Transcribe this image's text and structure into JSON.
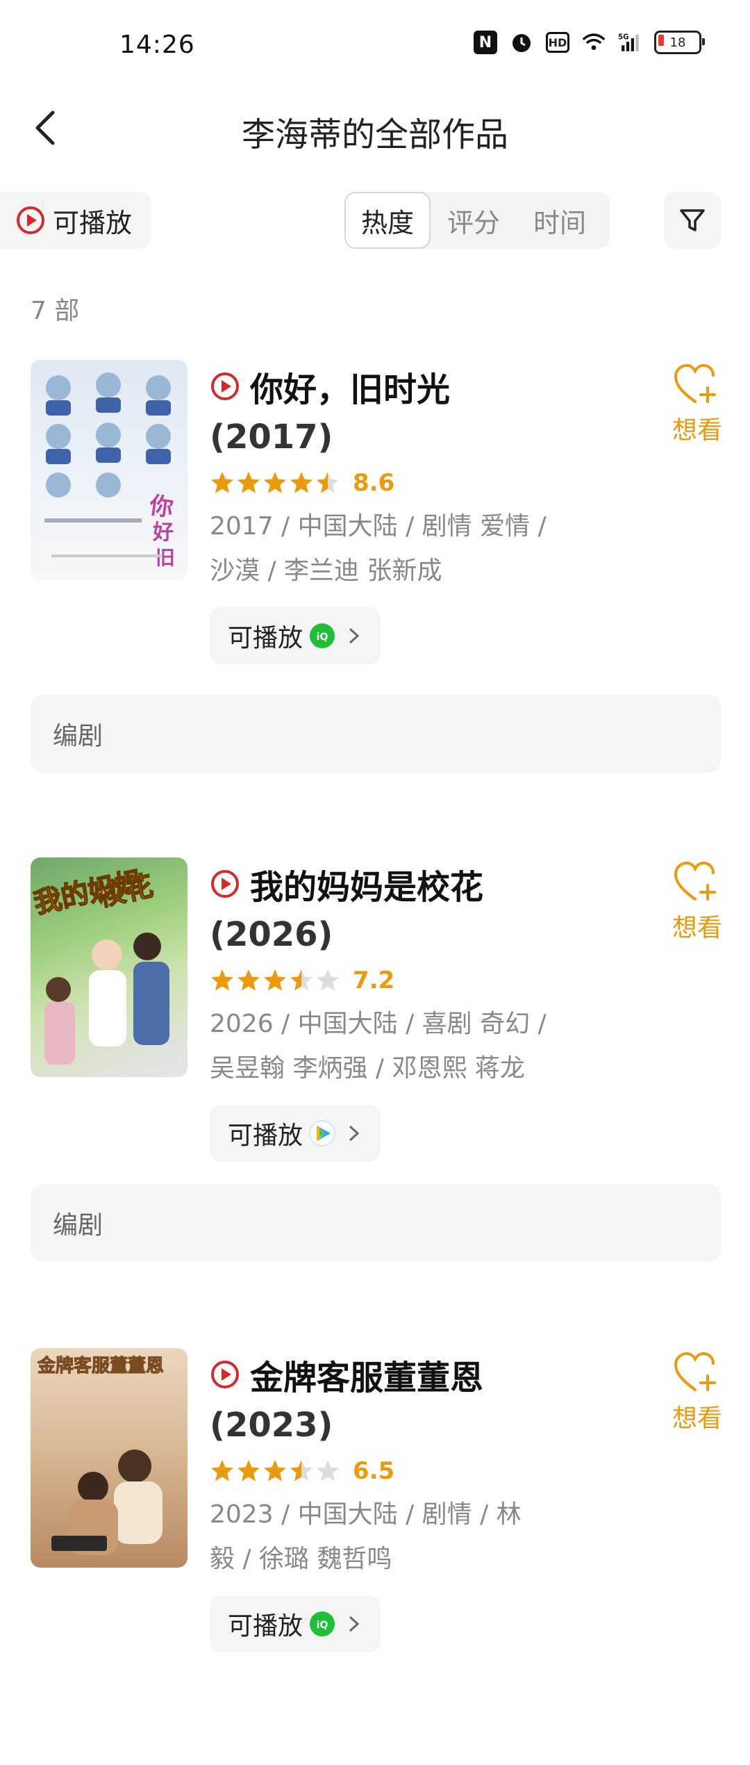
{
  "status_bar": {
    "time": "14:26",
    "icons": [
      "nfc-icon",
      "alarm-icon",
      "hd-icon",
      "wifi-icon",
      "5g-signal-icon"
    ],
    "battery": "18"
  },
  "header": {
    "title": "李海蒂的全部作品",
    "back_icon": "chevron-left-icon"
  },
  "filters": {
    "playable_label": "可播放",
    "sort_tabs": [
      {
        "label": "热度",
        "active": true
      },
      {
        "label": "评分",
        "active": false
      },
      {
        "label": "时间",
        "active": false
      }
    ],
    "filter_icon": "funnel-icon"
  },
  "count_text": "7 部",
  "colors": {
    "accent": "#e99b0d",
    "play_red": "#d42a2a",
    "chip_bg": "#f5f5f5"
  },
  "works": [
    {
      "title": "你好，旧时光",
      "year": "(2017)",
      "rating": 8.6,
      "stars": 4.5,
      "meta_line1": "2017 / 中国大陆 / 剧情 爱情 /",
      "meta_line2": "沙漠 / 李兰迪 张新成",
      "play_label": "可播放",
      "platform": "iqiyi-icon",
      "want_label": "想看",
      "role": "编剧",
      "poster_text": "你好旧时光"
    },
    {
      "title": "我的妈妈是校花",
      "year": "(2026)",
      "rating": 7.2,
      "stars": 3.5,
      "meta_line1": "2026 / 中国大陆 / 喜剧 奇幻 /",
      "meta_line2": "吴昱翰 李炳强 / 邓恩熙 蒋龙",
      "play_label": "可播放",
      "platform": "tencent-video-icon",
      "want_label": "想看",
      "role": "编剧",
      "poster_text": "我的妈妈是校花"
    },
    {
      "title": "金牌客服董董恩",
      "year": "(2023)",
      "rating": 6.5,
      "stars": 3.5,
      "meta_line1": "2023 / 中国大陆 / 剧情 / 林",
      "meta_line2": "毅 / 徐璐 魏哲鸣",
      "play_label": "可播放",
      "platform": "iqiyi-icon",
      "want_label": "想看",
      "role": "",
      "poster_text": "金牌客服董董恩"
    }
  ]
}
